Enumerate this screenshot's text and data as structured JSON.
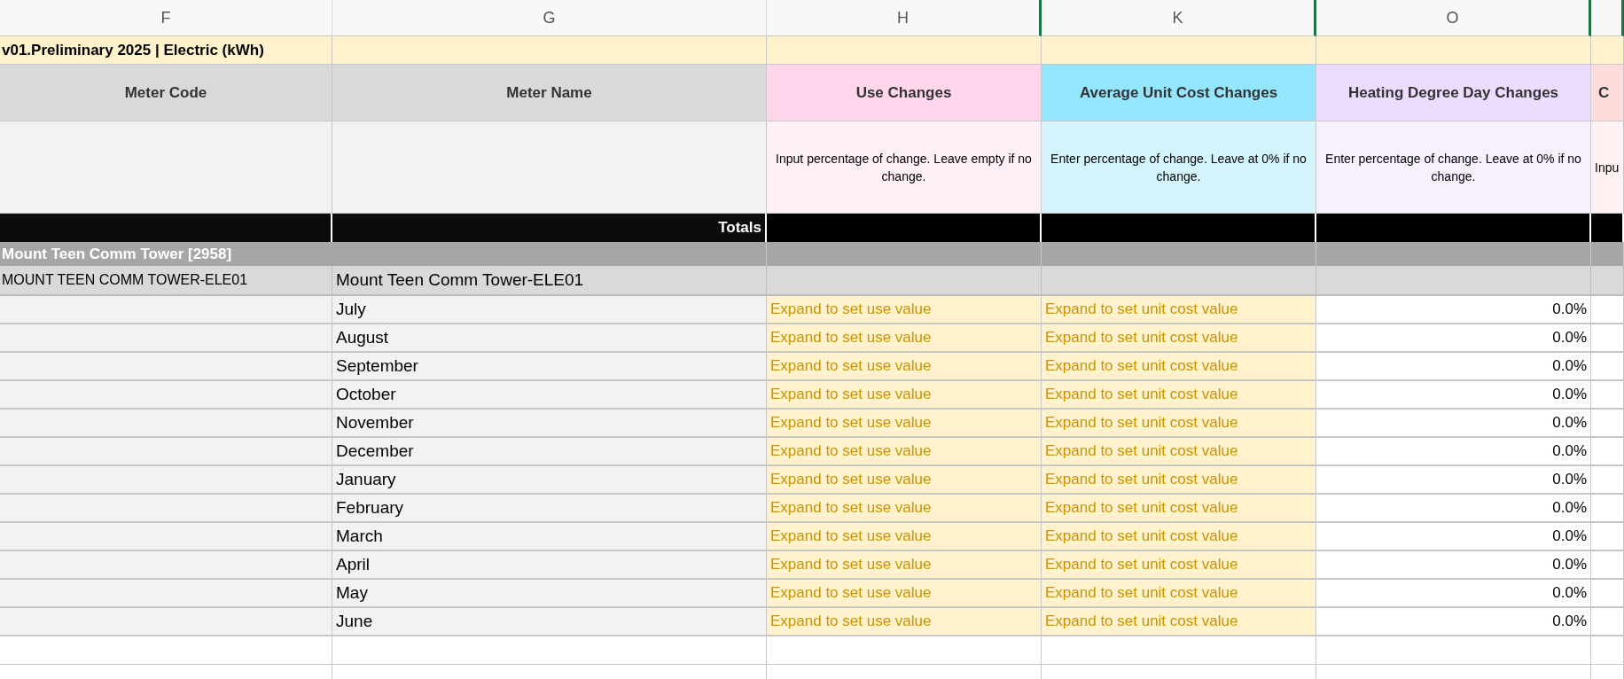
{
  "column_letters": [
    "F",
    "G",
    "H",
    "K",
    "O"
  ],
  "title": "v01.Preliminary 2025 | Electric (kWh)",
  "fixed_headers": [
    "Meter Code",
    "Meter Name"
  ],
  "change_columns": [
    {
      "label": "Use Changes",
      "color": "#ffd6ec",
      "note": "Input percentage of change. Leave empty if no change."
    },
    {
      "label": "Average Unit Cost Changes",
      "color": "#93e6fc",
      "note": "Enter percentage of change.  Leave at 0% if no change."
    },
    {
      "label": "Heating Degree Day Changes",
      "color": "#ecdcff",
      "note": "Enter percentage of change. Leave at 0% if no change."
    },
    {
      "label": "C",
      "color": "#fddcdc",
      "note": "Inpu"
    }
  ],
  "totals_label": "Totals",
  "group": "Mount Teen Comm Tower [2958]",
  "meter": {
    "code": "MOUNT TEEN COMM TOWER-ELE01",
    "name": "Mount Teen Comm Tower-ELE01"
  },
  "rows": [
    {
      "month": "July",
      "use": "Expand to set use value",
      "cost": "Expand to set unit cost value",
      "hdd": "0.0%"
    },
    {
      "month": "August",
      "use": "Expand to set use value",
      "cost": "Expand to set unit cost value",
      "hdd": "0.0%"
    },
    {
      "month": "September",
      "use": "Expand to set use value",
      "cost": "Expand to set unit cost value",
      "hdd": "0.0%"
    },
    {
      "month": "October",
      "use": "Expand to set use value",
      "cost": "Expand to set unit cost value",
      "hdd": "0.0%"
    },
    {
      "month": "November",
      "use": "Expand to set use value",
      "cost": "Expand to set unit cost value",
      "hdd": "0.0%"
    },
    {
      "month": "December",
      "use": "Expand to set use value",
      "cost": "Expand to set unit cost value",
      "hdd": "0.0%"
    },
    {
      "month": "January",
      "use": "Expand to set use value",
      "cost": "Expand to set unit cost value",
      "hdd": "0.0%"
    },
    {
      "month": "February",
      "use": "Expand to set use value",
      "cost": "Expand to set unit cost value",
      "hdd": "0.0%"
    },
    {
      "month": "March",
      "use": "Expand to set use value",
      "cost": "Expand to set unit cost value",
      "hdd": "0.0%"
    },
    {
      "month": "April",
      "use": "Expand to set use value",
      "cost": "Expand to set unit cost value",
      "hdd": "0.0%"
    },
    {
      "month": "May",
      "use": "Expand to set use value",
      "cost": "Expand to set unit cost value",
      "hdd": "0.0%"
    },
    {
      "month": "June",
      "use": "Expand to set use value",
      "cost": "Expand to set unit cost value",
      "hdd": "0.0%"
    }
  ]
}
